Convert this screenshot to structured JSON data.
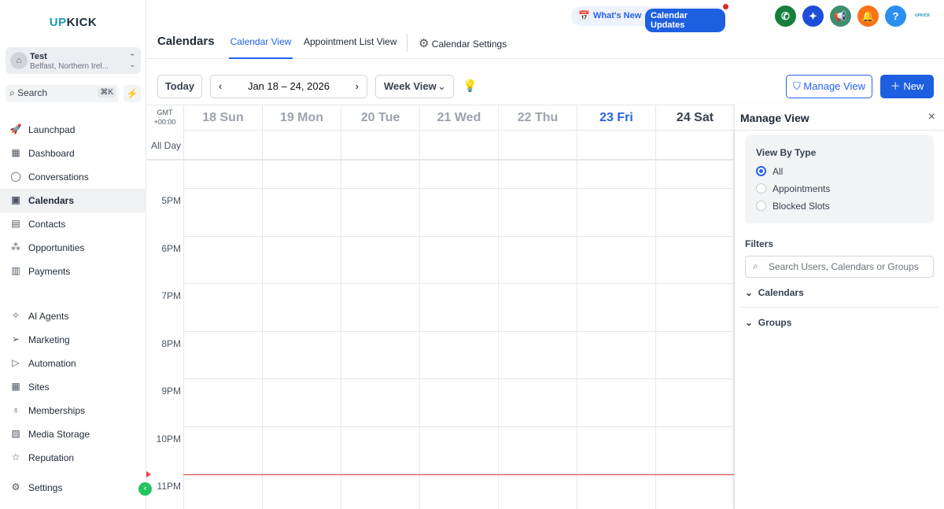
{
  "sidebar": {
    "logo_up": "UP",
    "logo_rest": "KICK",
    "account": {
      "name": "Test",
      "location": "Belfast, Northern Irel..."
    },
    "search": {
      "label": "Search",
      "shortcut": "⌘K"
    },
    "items": [
      {
        "label": "Launchpad",
        "icon": "rocket-icon"
      },
      {
        "label": "Dashboard",
        "icon": "grid-icon"
      },
      {
        "label": "Conversations",
        "icon": "chat-icon"
      },
      {
        "label": "Calendars",
        "icon": "calendar-icon"
      },
      {
        "label": "Contacts",
        "icon": "contacts-icon"
      },
      {
        "label": "Opportunities",
        "icon": "pipeline-icon"
      },
      {
        "label": "Payments",
        "icon": "receipt-icon"
      },
      {
        "label": "AI Agents",
        "icon": "sparkle-icon"
      },
      {
        "label": "Marketing",
        "icon": "send-icon"
      },
      {
        "label": "Automation",
        "icon": "play-icon"
      },
      {
        "label": "Sites",
        "icon": "globe-icon"
      },
      {
        "label": "Memberships",
        "icon": "award-icon"
      },
      {
        "label": "Media Storage",
        "icon": "image-icon"
      },
      {
        "label": "Reputation",
        "icon": "star-icon"
      },
      {
        "label": "Settings",
        "icon": "gear-icon"
      }
    ]
  },
  "topbar": {
    "whats_new": "What's New",
    "calendar_updates": "Calendar Updates",
    "mini_logo": "UPKICK",
    "help": "?"
  },
  "header": {
    "title": "Calendars",
    "tabs": [
      "Calendar View",
      "Appointment List View",
      "Calendar Settings"
    ]
  },
  "toolbar": {
    "today": "Today",
    "range": "Jan 18 – 24, 2026",
    "view": "Week View",
    "manage_view": "Manage View",
    "new": "New"
  },
  "calendar": {
    "timezone": "GMT\n+00:00",
    "all_day": "All Day",
    "days": [
      "18 Sun",
      "19 Mon",
      "20 Tue",
      "21 Wed",
      "22 Thu",
      "23 Fri",
      "24 Sat"
    ],
    "today_index": 5,
    "hours": [
      "5PM",
      "6PM",
      "7PM",
      "8PM",
      "9PM",
      "10PM",
      "11PM"
    ]
  },
  "manage_view": {
    "title": "Manage View",
    "view_by_type": "View By Type",
    "options": [
      "All",
      "Appointments",
      "Blocked Slots"
    ],
    "selected": 0,
    "filters": "Filters",
    "filter_placeholder": "Search Users, Calendars or Groups",
    "sections": [
      "Calendars",
      "Groups"
    ]
  },
  "colors": {
    "accent": "#2563eb",
    "now_line": "#ef4444"
  }
}
